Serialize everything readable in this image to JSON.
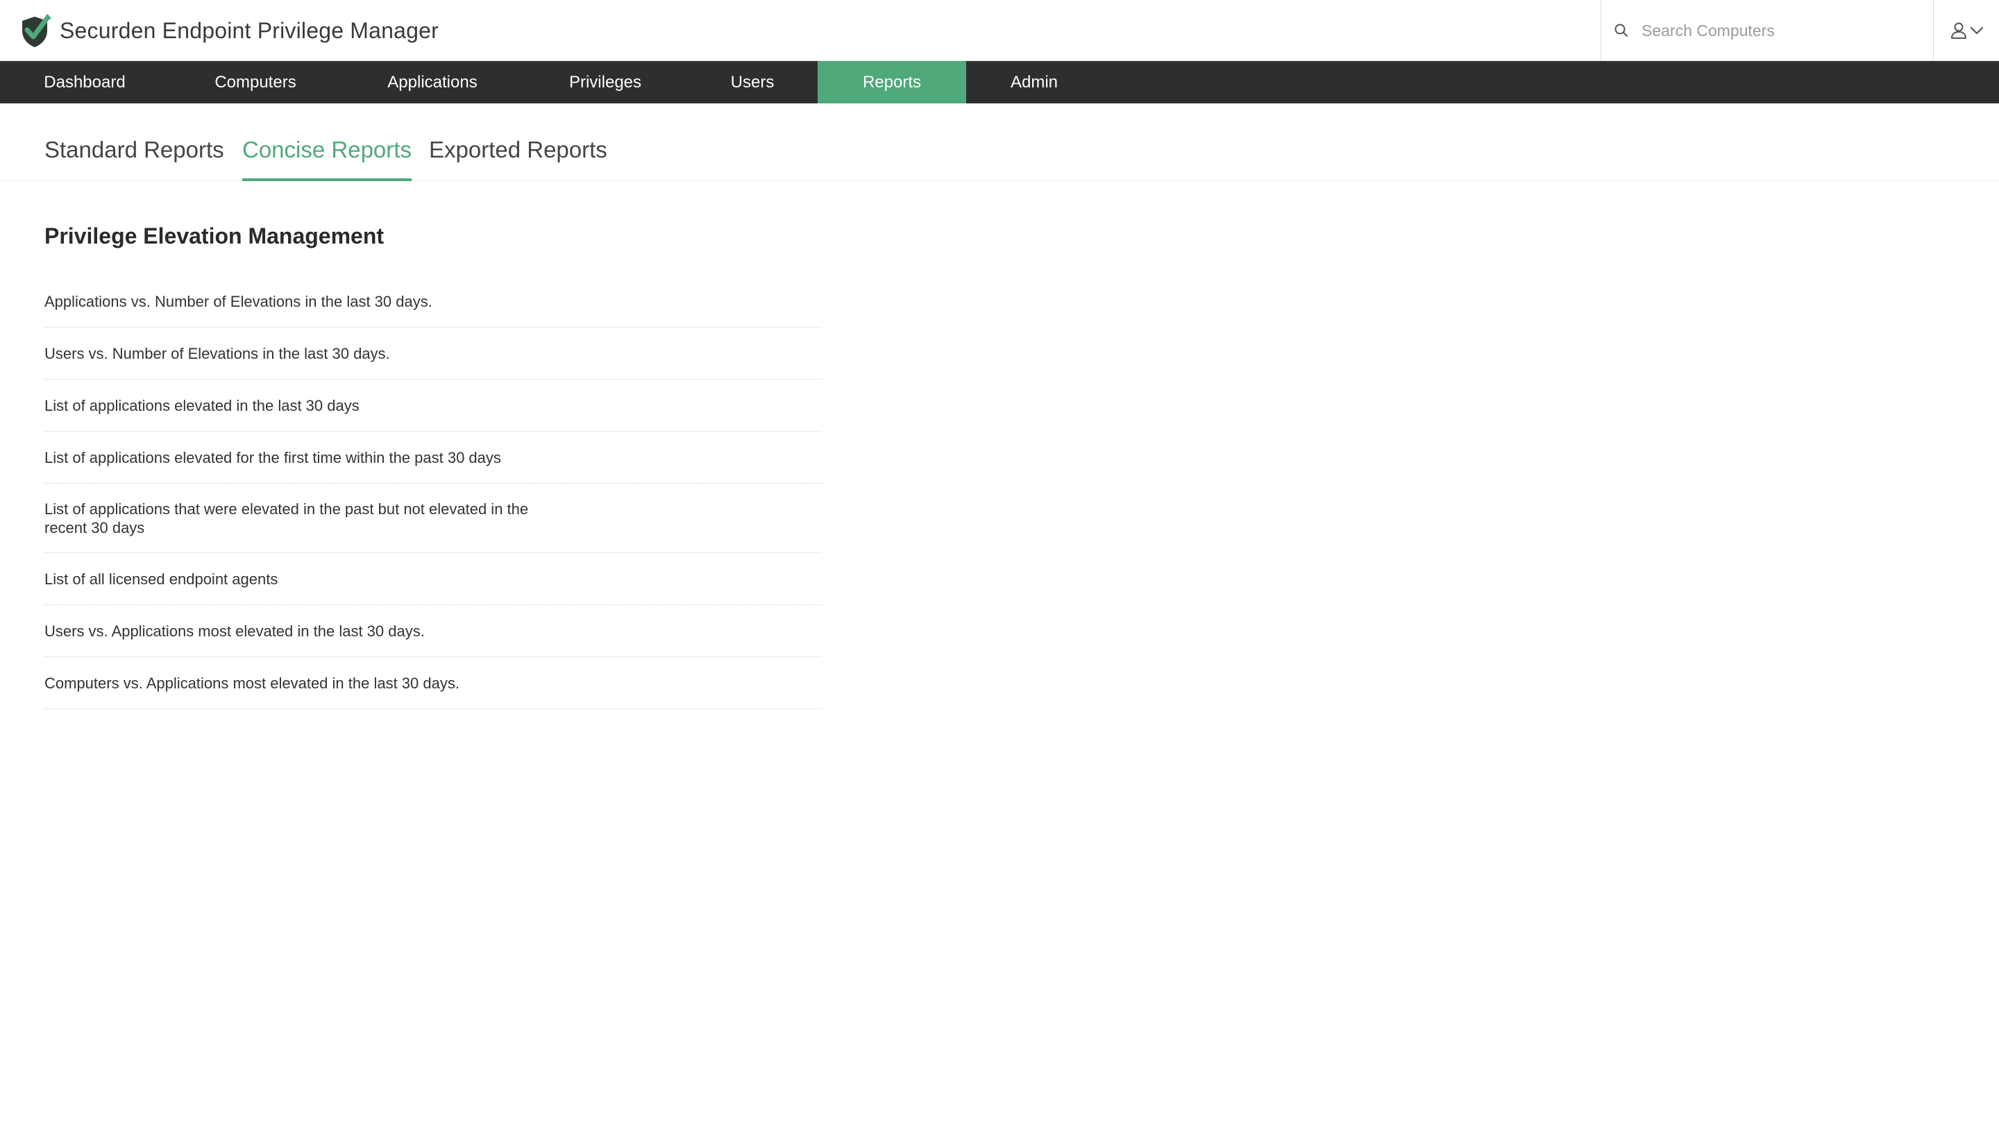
{
  "app": {
    "title": "Securden Endpoint Privilege Manager",
    "brand_color": "#4fa97a"
  },
  "search": {
    "placeholder": "Search Computers",
    "icon": "search-icon"
  },
  "user_menu": {
    "icon": "user-icon",
    "caret_icon": "chevron-down-icon"
  },
  "nav": {
    "active": "Reports",
    "items": [
      "Dashboard",
      "Computers",
      "Applications",
      "Privileges",
      "Users",
      "Reports",
      "Admin"
    ]
  },
  "subtabs": {
    "active": "Concise Reports",
    "items": [
      "Standard Reports",
      "Concise Reports",
      "Exported Reports"
    ]
  },
  "section": {
    "title": "Privilege Elevation Management",
    "reports": [
      "Applications vs. Number of Elevations in the last 30 days.",
      "Users vs. Number of Elevations in the last 30 days.",
      "List of applications elevated in the last 30 days",
      "List of applications elevated for the first time within the past 30 days",
      "List of applications that were elevated in the past but not elevated in the recent 30 days",
      "List of all licensed endpoint agents",
      "Users vs. Applications most elevated in the last 30 days.",
      "Computers vs. Applications most elevated in the last 30 days."
    ]
  }
}
